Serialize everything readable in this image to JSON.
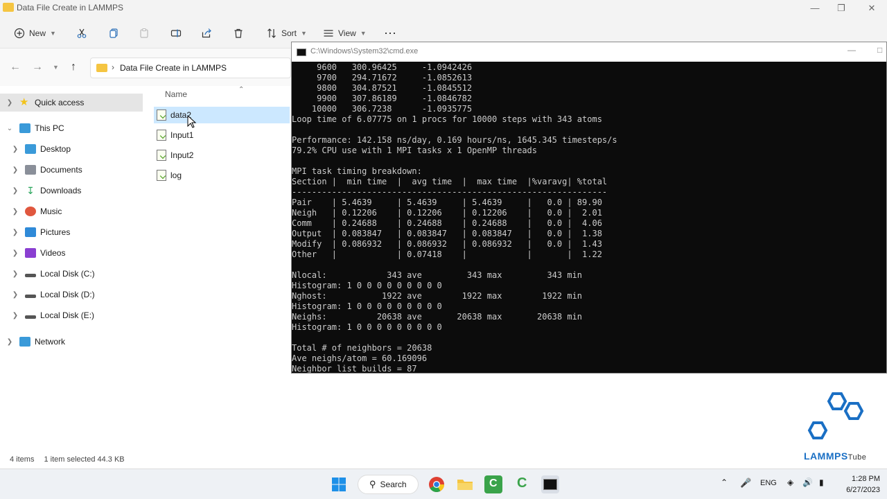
{
  "window": {
    "title": "Data File Create in LAMMPS"
  },
  "toolbar": {
    "new_label": "New",
    "sort_label": "Sort",
    "view_label": "View"
  },
  "address": {
    "path": "Data File Create in LAMMPS"
  },
  "sidebar": {
    "items": [
      {
        "label": "Quick access",
        "icon": "star-icon",
        "color": "#f2c31b"
      },
      {
        "label": "This PC",
        "icon": "monitor-icon",
        "color": "#3a9ad9"
      },
      {
        "label": "Desktop",
        "icon": "desktop-icon",
        "color": "#3a9ad9"
      },
      {
        "label": "Documents",
        "icon": "documents-icon",
        "color": "#8a8f99"
      },
      {
        "label": "Downloads",
        "icon": "download-icon",
        "color": "#2aa55c"
      },
      {
        "label": "Music",
        "icon": "music-icon",
        "color": "#e0573e"
      },
      {
        "label": "Pictures",
        "icon": "pictures-icon",
        "color": "#2f8ad8"
      },
      {
        "label": "Videos",
        "icon": "videos-icon",
        "color": "#8a3fd1"
      },
      {
        "label": "Local Disk (C:)",
        "icon": "drive-icon",
        "color": "#555"
      },
      {
        "label": "Local Disk (D:)",
        "icon": "drive-icon",
        "color": "#555"
      },
      {
        "label": "Local Disk (E:)",
        "icon": "drive-icon",
        "color": "#555"
      },
      {
        "label": "Network",
        "icon": "network-icon",
        "color": "#3a9ad9"
      }
    ]
  },
  "filelist": {
    "column_name": "Name",
    "files": [
      "data2",
      "Input1",
      "Input2",
      "log"
    ]
  },
  "status": {
    "count": "4 items",
    "selection": "1 item selected  44.3 KB"
  },
  "cmd": {
    "title": "C:\\Windows\\System32\\cmd.exe",
    "output": "     9600   300.96425     -1.0942426 \n     9700   294.71672     -1.0852613 \n     9800   304.87521     -1.0845512 \n     9900   307.86189     -1.0846782 \n    10000   306.7238      -1.0935775 \nLoop time of 6.07775 on 1 procs for 10000 steps with 343 atoms\n\nPerformance: 142.158 ns/day, 0.169 hours/ns, 1645.345 timesteps/s\n79.2% CPU use with 1 MPI tasks x 1 OpenMP threads\n\nMPI task timing breakdown:\nSection |  min time  |  avg time  |  max time  |%varavg| %total\n---------------------------------------------------------------\nPair    | 5.4639     | 5.4639     | 5.4639     |   0.0 | 89.90\nNeigh   | 0.12206    | 0.12206    | 0.12206    |   0.0 |  2.01\nComm    | 0.24688    | 0.24688    | 0.24688    |   0.0 |  4.06\nOutput  | 0.083847   | 0.083847   | 0.083847   |   0.0 |  1.38\nModify  | 0.086932   | 0.086932   | 0.086932   |   0.0 |  1.43\nOther   |            | 0.07418    |            |       |  1.22\n\nNlocal:            343 ave         343 max         343 min\nHistogram: 1 0 0 0 0 0 0 0 0 0\nNghost:           1922 ave        1922 max        1922 min\nHistogram: 1 0 0 0 0 0 0 0 0 0\nNeighs:          20638 ave       20638 max       20638 min\nHistogram: 1 0 0 0 0 0 0 0 0 0\n\nTotal # of neighbors = 20638\nAve neighs/atom = 60.169096\nNeighbor list builds = 87"
  },
  "taskbar": {
    "search_label": "Search",
    "lang": "ENG",
    "time": "1:28 PM",
    "date": "6/27/2023"
  },
  "logo": {
    "text": "LAMMPS",
    "suffix": "Tube"
  }
}
